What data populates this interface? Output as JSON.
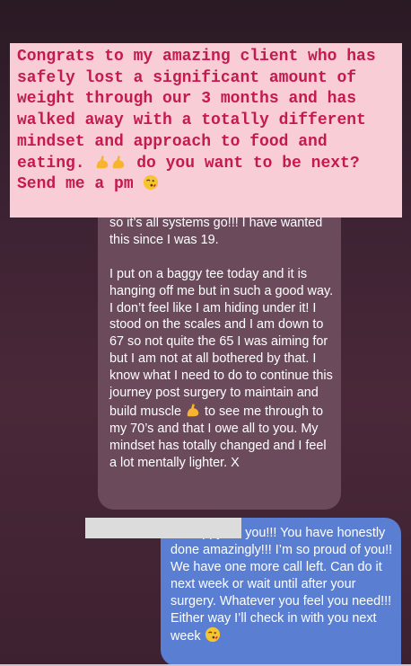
{
  "banner": {
    "text_main": "Congrats to my amazing client who has safely lost a significant amount of weight through our 3 months and has walked away with a totally different mindset and approach to food and eating. ",
    "text_cta": " do you want to be next? Send me a pm ",
    "emoji_flex": "flexed-biceps-emoji",
    "emoji_kiss": "kissing-face-emoji"
  },
  "incoming_message": {
    "para1": "so it’s all systems go!!! I have wanted this since I was 19.",
    "para2_a": "I put on a baggy tee today and it is hanging off me but in such a good way. I don’t feel like I am hiding under it! I stood on the scales and I am down to 67 so not quite the 65 I was aiming for but I am not at all bothered by that. I know what I need to do to continue this journey post surgery to maintain and build muscle ",
    "para2_b": " to see me through to my 70’s and that I owe all to you. My mindset has totally changed and I feel a lot mentally lighter. X",
    "emoji": "flexed-biceps-emoji"
  },
  "outgoing_message": {
    "text": "so happy for you!!! You have honestly done amazingly!!! I’m so proud of you!! We have one more call left. Can do it next week or wait until after your surgery. Whatever you feel you need!!! Either way I’ll check in with you next week ",
    "emoji": "kissing-face-emoji"
  },
  "colors": {
    "banner_bg": "#f9cdd5",
    "banner_text": "#c41a4e",
    "incoming_bubble": "#6b4a5c",
    "outgoing_bubble": "#5a7fd2"
  }
}
